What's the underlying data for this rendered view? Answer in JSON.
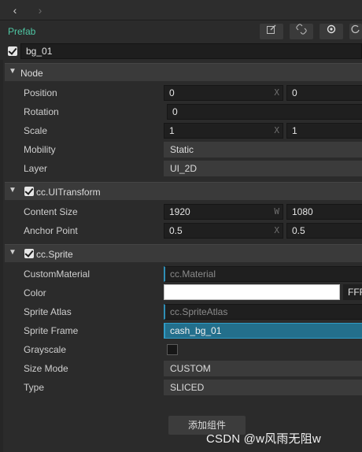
{
  "nav": {
    "back_icon": "‹",
    "forward_icon": "›"
  },
  "prefab": {
    "label": "Prefab",
    "tools": [
      "edit-icon",
      "unlink-icon",
      "locate-icon",
      "refresh-icon"
    ]
  },
  "node_name": "bg_01",
  "sections": {
    "node": {
      "title": "Node",
      "position": {
        "label": "Position",
        "x": "0",
        "y": "0"
      },
      "rotation": {
        "label": "Rotation",
        "value": "0"
      },
      "scale": {
        "label": "Scale",
        "x": "1",
        "y": "1"
      },
      "mobility": {
        "label": "Mobility",
        "value": "Static"
      },
      "layer": {
        "label": "Layer",
        "value": "UI_2D"
      }
    },
    "ui_transform": {
      "title": "cc.UITransform",
      "content_size": {
        "label": "Content Size",
        "w": "1920",
        "h": "1080"
      },
      "anchor_point": {
        "label": "Anchor Point",
        "x": "0.5",
        "y": "0.5"
      }
    },
    "sprite": {
      "title": "cc.Sprite",
      "custom_material": {
        "label": "CustomMaterial",
        "value": "cc.Material"
      },
      "color": {
        "label": "Color",
        "hex": "FFF"
      },
      "sprite_atlas": {
        "label": "Sprite Atlas",
        "value": "cc.SpriteAtlas"
      },
      "sprite_frame": {
        "label": "Sprite Frame",
        "value": "cash_bg_01"
      },
      "grayscale": {
        "label": "Grayscale"
      },
      "size_mode": {
        "label": "Size Mode",
        "value": "CUSTOM"
      },
      "type": {
        "label": "Type",
        "value": "SLICED"
      }
    }
  },
  "axis": {
    "x": "X",
    "w": "W"
  },
  "add_component": "添加组件",
  "watermark": "CSDN @w风雨无阻w",
  "colors": {
    "accent": "#4fc7a4",
    "selected": "#236f8c"
  }
}
